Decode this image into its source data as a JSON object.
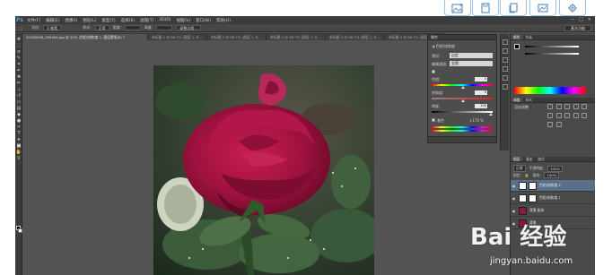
{
  "site_toolbar": {
    "buttons": [
      {
        "icon": "image-upload-icon"
      },
      {
        "icon": "save-icon"
      },
      {
        "icon": "copy-icon"
      },
      {
        "icon": "screenshot-icon"
      },
      {
        "icon": "settings-icon"
      }
    ]
  },
  "app": {
    "logo": "Ps",
    "menu": [
      "文件(F)",
      "编辑(E)",
      "图像(I)",
      "图层(L)",
      "类型(Y)",
      "选择(S)",
      "滤镜(T)",
      "3D(D)",
      "视图(V)",
      "窗口(W)",
      "帮助(H)"
    ],
    "window_controls": [
      "—",
      "□",
      "✕"
    ]
  },
  "options_bar": {
    "feather_label": "羽化:",
    "feather_value": "0 像素",
    "style_label": "样式:",
    "style_value": "正常",
    "width_label": "宽度:",
    "height_label": "高度:",
    "refine_edge": "调整边缘...",
    "workspace": "基本功能"
  },
  "doc_tabs": [
    {
      "label": "20150528_095404.jpg @ 25% (色相/饱和度 1, 图层蒙版/8) *",
      "active": true
    },
    {
      "label": "未标题-1 @ 66.7% (图层 1, R...",
      "active": false
    },
    {
      "label": "未标题-2 @ 66.7% (图层 1, R...",
      "active": false
    },
    {
      "label": "未标题-3 @ 66.7% (图层 1, R...",
      "active": false
    },
    {
      "label": "未标题-4 @ 66.7% (图层 1, R...",
      "active": false
    },
    {
      "label": "未标题-5 @ 66.7% (图层 1, R...",
      "active": false
    }
  ],
  "properties": {
    "title": "属性",
    "header": "色相/饱和度",
    "preset_label": "预设:",
    "preset_value": "自定",
    "channel_label": "编辑通道:",
    "channel_value": "全图",
    "hue_label": "色相:",
    "hue_value": "0",
    "saturation_label": "饱和度:",
    "saturation_value": "0",
    "lightness_label": "明度:",
    "lightness_value": "100",
    "colorize_label": "着色",
    "range_values": "+170 %"
  },
  "right_panels": {
    "color_tabs": [
      "颜色",
      "色板"
    ],
    "adjust_tabs": [
      "调整",
      "样式"
    ],
    "add_adjustment": "添加调整",
    "layers_tabs": [
      "图层",
      "通道",
      "路径"
    ],
    "blend_mode": "正常",
    "opacity_label": "不透明度:",
    "opacity_value": "100%",
    "lock_label": "锁定:",
    "fill_label": "填充:",
    "fill_value": "100%"
  },
  "layers": [
    {
      "name": "色相/饱和度 2",
      "thumb_color": "#ffffff",
      "has_mask": true,
      "active": true
    },
    {
      "name": "色相/饱和度 1",
      "thumb_color": "#ffffff",
      "has_mask": true,
      "active": false
    },
    {
      "name": "背景 副本",
      "thumb_color": "#8b1a3b",
      "has_mask": false,
      "active": false
    },
    {
      "name": "背景",
      "thumb_color": "#8b1a3b",
      "has_mask": false,
      "active": false
    }
  ],
  "watermark": {
    "main": "Bai 经验",
    "sub": "jingyan.baidu.com"
  },
  "colors": {
    "ps_dark": "#535353",
    "menubar": "#3c3c3c",
    "rose": "#a0123f",
    "accent_blue": "#9fc3e6"
  }
}
